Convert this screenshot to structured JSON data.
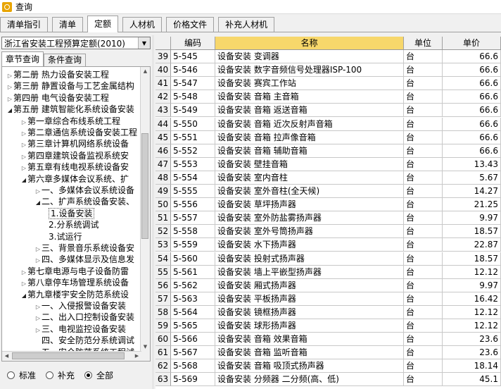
{
  "window": {
    "title": "查询"
  },
  "tabs": [
    {
      "label": "清单指引",
      "active": false
    },
    {
      "label": "清单",
      "active": false
    },
    {
      "label": "定额",
      "active": true
    },
    {
      "label": "人材机",
      "active": false
    },
    {
      "label": "价格文件",
      "active": false
    },
    {
      "label": "补充人材机",
      "active": false
    }
  ],
  "left": {
    "combo_value": "浙江省安装工程预算定额(2010)",
    "subtabs": [
      {
        "label": "章节查询",
        "active": true
      },
      {
        "label": "条件查询",
        "active": false
      }
    ],
    "tree": [
      {
        "label": "第二册 热力设备安装工程",
        "level": 0,
        "state": "closed"
      },
      {
        "label": "第三册 静置设备与工艺金属结构",
        "level": 0,
        "state": "closed"
      },
      {
        "label": "第四册 电气设备安装工程",
        "level": 0,
        "state": "closed"
      },
      {
        "label": "第五册 建筑智能化系统设备安装",
        "level": 0,
        "state": "open"
      },
      {
        "label": "第一章综合布线系统工程",
        "level": 1,
        "state": "closed"
      },
      {
        "label": "第二章通信系统设备安装工程",
        "level": 1,
        "state": "closed"
      },
      {
        "label": "第三章计算机网络系统设备",
        "level": 1,
        "state": "closed"
      },
      {
        "label": "第四章建筑设备监视系统安",
        "level": 1,
        "state": "closed"
      },
      {
        "label": "第五章有线电视系统设备安",
        "level": 1,
        "state": "closed"
      },
      {
        "label": "第六章多媒体会议系统、扩",
        "level": 1,
        "state": "open"
      },
      {
        "label": "一、多媒体会议系统设备",
        "level": 2,
        "state": "closed"
      },
      {
        "label": "二、扩声系统设备安装、",
        "level": 2,
        "state": "open"
      },
      {
        "label": "1.设备安装",
        "level": 3,
        "state": "leaf",
        "selected": true
      },
      {
        "label": "2.分系统调试",
        "level": 3,
        "state": "leaf"
      },
      {
        "label": "3.试运行",
        "level": 3,
        "state": "leaf"
      },
      {
        "label": "三、背景音乐系统设备安",
        "level": 2,
        "state": "closed"
      },
      {
        "label": "四、多媒体显示及信息发",
        "level": 2,
        "state": "closed"
      },
      {
        "label": "第七章电源与电子设备防雷",
        "level": 1,
        "state": "closed"
      },
      {
        "label": "第八章停车场管理系统设备",
        "level": 1,
        "state": "closed"
      },
      {
        "label": "第九章楼宇安全防范系统设",
        "level": 1,
        "state": "open"
      },
      {
        "label": "一、入侵报警设备安装",
        "level": 2,
        "state": "closed"
      },
      {
        "label": "二、出入口控制设备安装",
        "level": 2,
        "state": "closed"
      },
      {
        "label": "三、电视监控设备安装",
        "level": 2,
        "state": "closed"
      },
      {
        "label": "四、安全防范分系统调试",
        "level": 2,
        "state": "leaf"
      },
      {
        "label": "五、安全防范系统工程试",
        "level": 2,
        "state": "leaf"
      }
    ],
    "radios": [
      {
        "label": "标准",
        "checked": false
      },
      {
        "label": "补充",
        "checked": false
      },
      {
        "label": "全部",
        "checked": true
      }
    ]
  },
  "grid": {
    "columns": [
      "编码",
      "名称",
      "单位",
      "单价"
    ],
    "rows": [
      {
        "n": "39",
        "code": "5-545",
        "name": "设备安装 变调器",
        "unit": "台",
        "price": "66.6"
      },
      {
        "n": "40",
        "code": "5-546",
        "name": "设备安装 数字音频信号处理器ISP-100",
        "unit": "台",
        "price": "66.6"
      },
      {
        "n": "41",
        "code": "5-547",
        "name": "设备安装 赛宾工作站",
        "unit": "台",
        "price": "66.6"
      },
      {
        "n": "42",
        "code": "5-548",
        "name": "设备安装 音箱 主音箱",
        "unit": "台",
        "price": "66.6"
      },
      {
        "n": "43",
        "code": "5-549",
        "name": "设备安装 音箱 返送音箱",
        "unit": "台",
        "price": "66.6"
      },
      {
        "n": "44",
        "code": "5-550",
        "name": "设备安装 音箱 近次反射声音箱",
        "unit": "台",
        "price": "66.6"
      },
      {
        "n": "45",
        "code": "5-551",
        "name": "设备安装 音箱 拉声像音箱",
        "unit": "台",
        "price": "66.6"
      },
      {
        "n": "46",
        "code": "5-552",
        "name": "设备安装 音箱 辅助音箱",
        "unit": "台",
        "price": "66.6"
      },
      {
        "n": "47",
        "code": "5-553",
        "name": "设备安装 壁挂音箱",
        "unit": "台",
        "price": "13.43"
      },
      {
        "n": "48",
        "code": "5-554",
        "name": "设备安装 室内音柱",
        "unit": "台",
        "price": "5.67"
      },
      {
        "n": "49",
        "code": "5-555",
        "name": "设备安装 室外音柱(全天候)",
        "unit": "台",
        "price": "14.27"
      },
      {
        "n": "50",
        "code": "5-556",
        "name": "设备安装 草坪扬声器",
        "unit": "台",
        "price": "21.25"
      },
      {
        "n": "51",
        "code": "5-557",
        "name": "设备安装 室外防盐雾扬声器",
        "unit": "台",
        "price": "9.97"
      },
      {
        "n": "52",
        "code": "5-558",
        "name": "设备安装 室外号筒扬声器",
        "unit": "台",
        "price": "18.57"
      },
      {
        "n": "53",
        "code": "5-559",
        "name": "设备安装 水下扬声器",
        "unit": "台",
        "price": "22.87"
      },
      {
        "n": "54",
        "code": "5-560",
        "name": "设备安装 投射式扬声器",
        "unit": "台",
        "price": "18.57"
      },
      {
        "n": "55",
        "code": "5-561",
        "name": "设备安装 墙上平嵌型扬声器",
        "unit": "台",
        "price": "12.12"
      },
      {
        "n": "56",
        "code": "5-562",
        "name": "设备安装 厢式扬声器",
        "unit": "台",
        "price": "9.97"
      },
      {
        "n": "57",
        "code": "5-563",
        "name": "设备安装 平板扬声器",
        "unit": "台",
        "price": "16.42"
      },
      {
        "n": "58",
        "code": "5-564",
        "name": "设备安装 镜框扬声器",
        "unit": "台",
        "price": "12.12"
      },
      {
        "n": "59",
        "code": "5-565",
        "name": "设备安装 球形扬声器",
        "unit": "台",
        "price": "12.12"
      },
      {
        "n": "60",
        "code": "5-566",
        "name": "设备安装 音箱 效果音箱",
        "unit": "台",
        "price": "23.6"
      },
      {
        "n": "61",
        "code": "5-567",
        "name": "设备安装 音箱 监听音箱",
        "unit": "台",
        "price": "23.6"
      },
      {
        "n": "62",
        "code": "5-568",
        "name": "设备安装 音箱 吸顶式扬声器",
        "unit": "台",
        "price": "18.14"
      },
      {
        "n": "63",
        "code": "5-569",
        "name": "设备安装 分频器 二分频(高、低)",
        "unit": "台",
        "price": "45.1"
      }
    ]
  }
}
